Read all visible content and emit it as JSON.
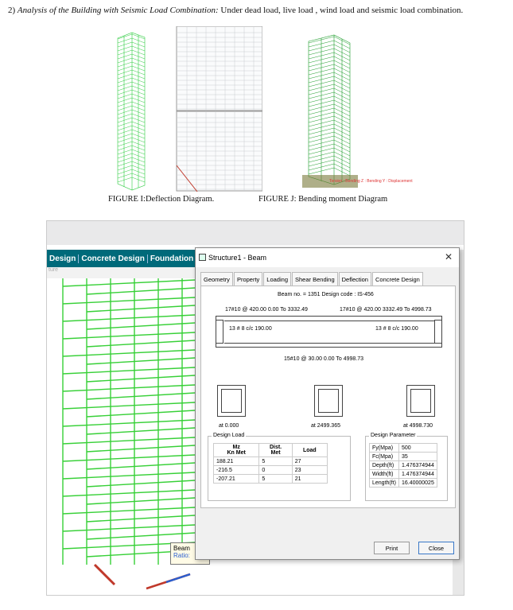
{
  "heading": {
    "number": "2)",
    "italic": "Analysis of the Building with Seismic Load Combination:",
    "text": "Under dead load, live load , wind load and seismic load combination."
  },
  "figures": {
    "caption_i": "FIGURE I:Deflection Diagram.",
    "caption_j": "FIGURE J: Bending moment Diagram",
    "legend_j": "Torsion : Bending Z : Bending Y : Displacement"
  },
  "app": {
    "ribbon": [
      "Design",
      "Concrete Design",
      "Foundation D"
    ],
    "subbar": "ture",
    "tooltip": [
      "Beam",
      "Ratio:"
    ]
  },
  "dialog": {
    "title": "Structure1 - Beam",
    "tabs": [
      "Geometry",
      "Property",
      "Loading",
      "Shear Bending",
      "Deflection",
      "Concrete Design"
    ],
    "active_tab": "Concrete Design",
    "beam_info": "Beam no. = 1351  Design code : IS-456",
    "top_left": "17#10 @ 420.00 0.00 To 3332.49",
    "top_right": "17#10 @ 420.00 3332.49 To 4998.73",
    "stirrup_left": "13 # 8 c/c 190.00",
    "stirrup_right": "13 # 8 c/c 190.00",
    "bottom": "15#10 @ 30.00 0.00 To 4998.73",
    "sec_labels": [
      "at 0.000",
      "at 2499.365",
      "at 4998.730"
    ],
    "design_load": {
      "label": "Design Load",
      "headers": [
        "Mz\nKn Met",
        "Dist.\nMet",
        "Load"
      ],
      "rows": [
        [
          "188.21",
          "5",
          "27"
        ],
        [
          "-216.5",
          "0",
          "23"
        ],
        [
          "-207.21",
          "5",
          "21"
        ]
      ]
    },
    "design_param": {
      "label": "Design Parameter",
      "rows": [
        [
          "Fy(Mpa)",
          "500"
        ],
        [
          "Fc(Mpa)",
          "35"
        ],
        [
          "Depth(ft)",
          "1.476374944"
        ],
        [
          "Width(ft)",
          "1.476374944"
        ],
        [
          "Length(ft)",
          "16.40000025"
        ]
      ]
    },
    "buttons": {
      "print": "Print",
      "close": "Close"
    }
  }
}
